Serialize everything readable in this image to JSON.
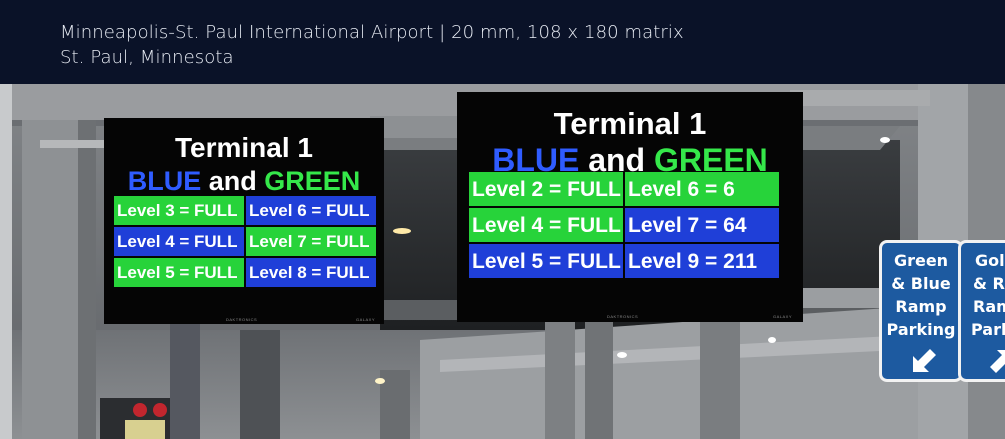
{
  "caption": {
    "line1": "Minneapolis-St. Paul International Airport  |  20 mm, 108 x 180 matrix",
    "line2": "St. Paul, Minnesota"
  },
  "sign_left": {
    "title": "Terminal 1",
    "sub_blue": "BLUE",
    "sub_and": "and",
    "sub_green": "GREEN",
    "cells": [
      {
        "text": "Level 3 = FULL",
        "bg": "green"
      },
      {
        "text": "Level 6 = FULL",
        "bg": "blue"
      },
      {
        "text": "Level 4 = FULL",
        "bg": "blue"
      },
      {
        "text": "Level 7 = FULL",
        "bg": "green"
      },
      {
        "text": "Level 5 = FULL",
        "bg": "green"
      },
      {
        "text": "Level 8 = FULL",
        "bg": "blue"
      }
    ],
    "maker_left": "DAKTRONICS",
    "maker_right": "GALAXY"
  },
  "sign_right": {
    "title": "Terminal 1",
    "sub_blue": "BLUE",
    "sub_and": "and",
    "sub_green": "GREEN",
    "cells": [
      {
        "text": "Level 2 = FULL",
        "bg": "green"
      },
      {
        "text": "Level 6 = 6",
        "bg": "green"
      },
      {
        "text": "Level 4 = FULL",
        "bg": "green"
      },
      {
        "text": "Level 7 = 64",
        "bg": "blue"
      },
      {
        "text": "Level 5 = FULL",
        "bg": "blue"
      },
      {
        "text": "Level 9 = 211",
        "bg": "blue"
      }
    ],
    "maker_center": "DAKTRONICS",
    "maker_right": "GALAXY"
  },
  "guide_sign_1": {
    "line1": "Green",
    "line2": "& Blue",
    "line3": "Ramp",
    "line4": "Parking",
    "arrow_icon": "arrow-down-left-icon"
  },
  "guide_sign_2": {
    "line1": "Gol",
    "line2": "& R",
    "line3": "Ram",
    "line4": "Park",
    "arrow_icon": "arrow-up-right-icon"
  },
  "colors": {
    "led_blue": "#1f3fd8",
    "led_green": "#27d33a",
    "text_blue": "#2f5cff",
    "text_green": "#35e84a",
    "caption_bg": "#0a1228",
    "guide_sign_blue": "#1d5aa0"
  }
}
